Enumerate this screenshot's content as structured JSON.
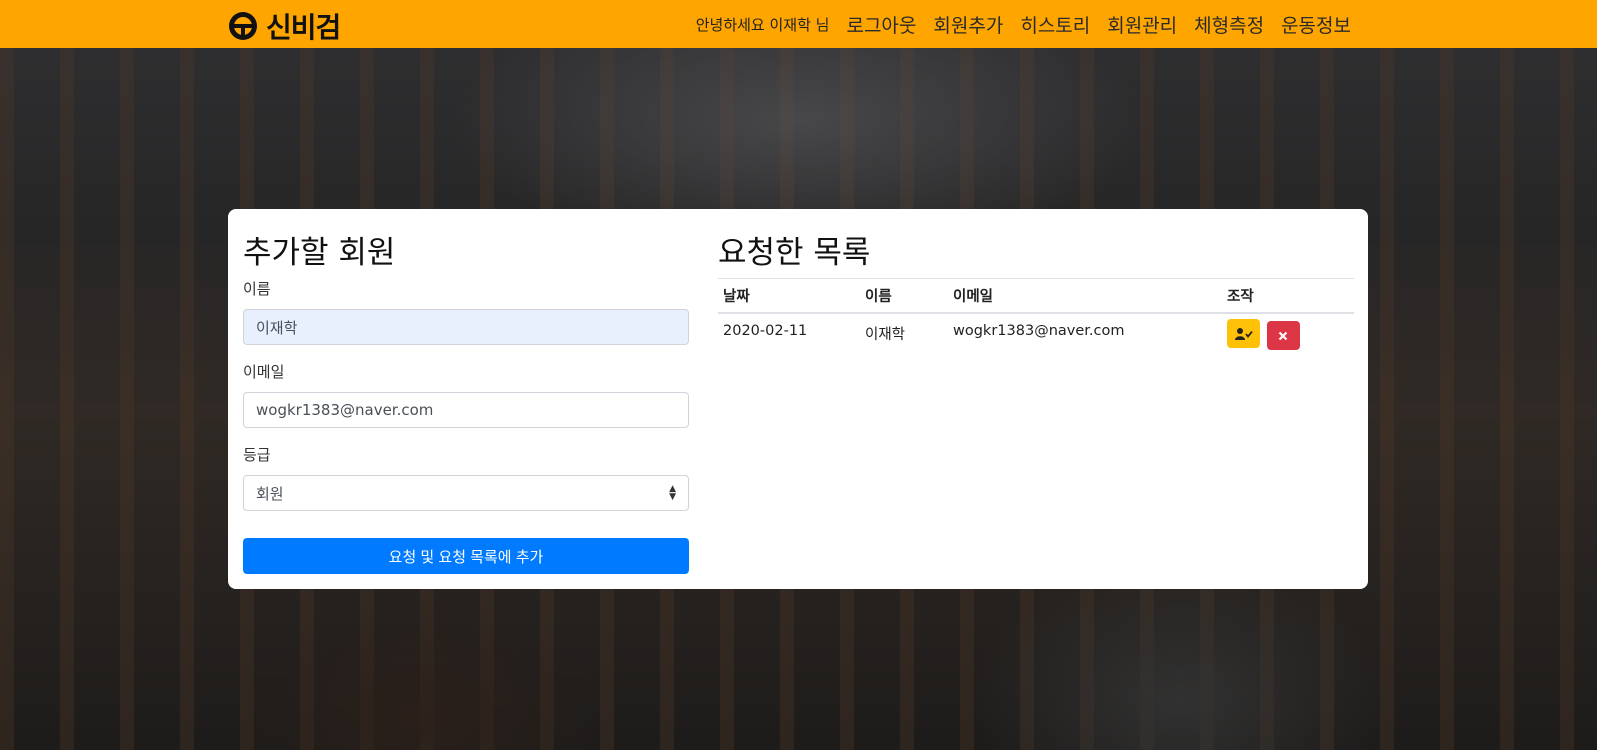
{
  "app": {
    "brand": "신비검",
    "brand_color": "#ffa500"
  },
  "nav": {
    "greeting": "안녕하세요 이재학 님",
    "items": [
      "로그아웃",
      "회원추가",
      "히스토리",
      "회원관리",
      "체형측정",
      "운동정보"
    ]
  },
  "form": {
    "title": "추가할 회원",
    "name_label": "이름",
    "name_value": "이재학",
    "email_label": "이메일",
    "email_value": "wogkr1383@naver.com",
    "grade_label": "등급",
    "grade_value": "회원",
    "submit_label": "요청 및 요청 목록에 추가",
    "submit_color": "#007bff"
  },
  "requests": {
    "title": "요청한 목록",
    "columns": [
      "날짜",
      "이름",
      "이메일",
      "조작"
    ],
    "rows": [
      {
        "date": "2020-02-11",
        "name": "이재학",
        "email": "wogkr1383@naver.com",
        "actions": [
          "user-check-icon",
          "close-icon"
        ]
      }
    ]
  },
  "colors": {
    "warning": "#ffc107",
    "danger": "#dc3545"
  }
}
